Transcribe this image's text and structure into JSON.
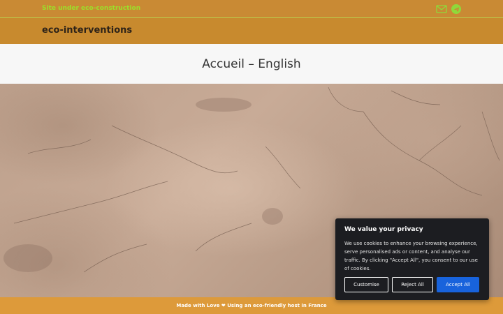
{
  "topbar": {
    "tagline": "Site under eco-construction",
    "icons": [
      "mail-icon",
      "telegram-icon"
    ],
    "tagline_color": "#9be02a"
  },
  "header": {
    "site_title": "eco-interventions"
  },
  "page": {
    "title": "Accueil – English"
  },
  "hero": {
    "image": "cracked-plaster-texture"
  },
  "footer": {
    "text": "Made with Love ❤ Using an eco-friendly host in France"
  },
  "cookie_banner": {
    "title": "We value your privacy",
    "body": "We use cookies to enhance your browsing experience, serve personalised ads or content, and analyse our traffic. By clicking \"Accept All\", you consent to our use of cookies.",
    "buttons": {
      "customise": "Customise",
      "reject": "Reject All",
      "accept": "Accept All"
    },
    "accent_color": "#1863dc"
  }
}
